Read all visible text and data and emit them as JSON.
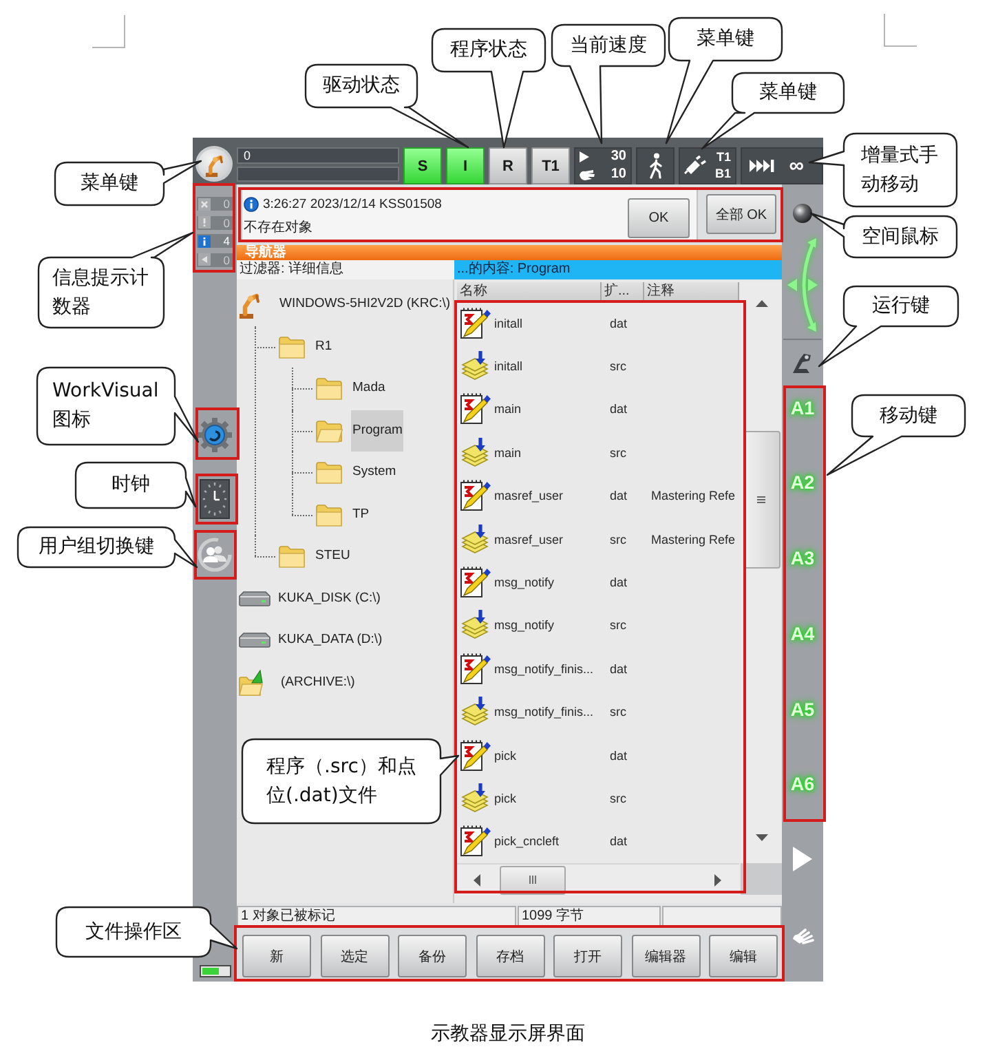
{
  "top_bar": {
    "status_field": {
      "value": "0"
    },
    "status_keys": [
      {
        "label": "S",
        "on": true
      },
      {
        "label": "I",
        "on": true
      },
      {
        "label": "R",
        "on": false
      },
      {
        "label": "T1",
        "on": false
      }
    ],
    "speed": {
      "program": "30",
      "jog": "10"
    },
    "tool": {
      "tool": "T1",
      "base": "B1"
    },
    "increment": {
      "value": "∞"
    }
  },
  "messages": {
    "counters": [
      {
        "kind": "acknowledge",
        "count": "0",
        "active": false
      },
      {
        "kind": "status",
        "count": "0",
        "active": false
      },
      {
        "kind": "info",
        "count": "4",
        "active": true
      },
      {
        "kind": "wait",
        "count": "0",
        "active": false
      }
    ],
    "entry": {
      "header": "3:26:27 2023/12/14 KSS01508",
      "text": "不存在对象"
    },
    "ok_button": "OK",
    "ok_all_button": "全部 OK"
  },
  "navigator": {
    "title": "导航器",
    "filter": "过滤器: 详细信息",
    "content_title": "...的内容: Program",
    "tree": [
      {
        "label": "WINDOWS-5HI2V2D (KRC:\\)",
        "kind": "robot",
        "selected": false,
        "children": [
          {
            "label": "R1",
            "kind": "folder",
            "selected": false,
            "children": [
              {
                "label": "Mada",
                "kind": "folder",
                "selected": false
              },
              {
                "label": "Program",
                "kind": "folder",
                "selected": true
              },
              {
                "label": "System",
                "kind": "folder",
                "selected": false
              },
              {
                "label": "TP",
                "kind": "folder",
                "selected": false
              }
            ]
          },
          {
            "label": "STEU",
            "kind": "folder",
            "selected": false
          }
        ]
      },
      {
        "label": "KUKA_DISK (C:\\)",
        "kind": "drive",
        "selected": false
      },
      {
        "label": "KUKA_DATA (D:\\)",
        "kind": "drive",
        "selected": false
      },
      {
        "label": "(ARCHIVE:\\)",
        "kind": "archive",
        "selected": false
      }
    ],
    "columns": [
      "名称",
      "扩...",
      "注释"
    ],
    "files": [
      {
        "name": "initall",
        "ext": "dat",
        "kind": "data"
      },
      {
        "name": "initall",
        "ext": "src",
        "kind": "source"
      },
      {
        "name": "main",
        "ext": "dat",
        "kind": "data"
      },
      {
        "name": "main",
        "ext": "src",
        "kind": "source"
      },
      {
        "name": "masref_user",
        "ext": "dat",
        "comment": "Mastering Refe",
        "kind": "data"
      },
      {
        "name": "masref_user",
        "ext": "src",
        "comment": "Mastering Refe",
        "kind": "source"
      },
      {
        "name": "msg_notify",
        "ext": "dat",
        "kind": "data"
      },
      {
        "name": "msg_notify",
        "ext": "src",
        "kind": "source"
      },
      {
        "name": "msg_notify_finis...",
        "ext": "dat",
        "kind": "data"
      },
      {
        "name": "msg_notify_finis...",
        "ext": "src",
        "kind": "source"
      },
      {
        "name": "pick",
        "ext": "dat",
        "kind": "data"
      },
      {
        "name": "pick",
        "ext": "src",
        "kind": "source"
      },
      {
        "name": "pick_cncleft",
        "ext": "dat",
        "kind": "data"
      }
    ],
    "status": [
      "1 对象已被标记",
      "1099 字节"
    ]
  },
  "file_buttons": [
    "新",
    "选定",
    "备份",
    "存档",
    "打开",
    "编辑器",
    "编辑"
  ],
  "axis_keys": [
    "A1",
    "A2",
    "A3",
    "A4",
    "A5",
    "A6"
  ],
  "callouts": [
    {
      "text": "菜单键"
    },
    {
      "text": "信息提示计数器"
    },
    {
      "text": "WorkVisual图标"
    },
    {
      "text": "时钟"
    },
    {
      "text": "用户组切换键"
    },
    {
      "text": "驱动状态"
    },
    {
      "text": "程序状态"
    },
    {
      "text": "当前速度"
    },
    {
      "text": "菜单键"
    },
    {
      "text": "菜单键"
    },
    {
      "text": "增量式手动移动"
    },
    {
      "text": "空间鼠标"
    },
    {
      "text": "运行键"
    },
    {
      "text": "移动键"
    },
    {
      "text": "程序（.src）和点位(.dat)文件"
    },
    {
      "text": "文件操作区"
    }
  ],
  "caption": "示教器显示屏界面"
}
